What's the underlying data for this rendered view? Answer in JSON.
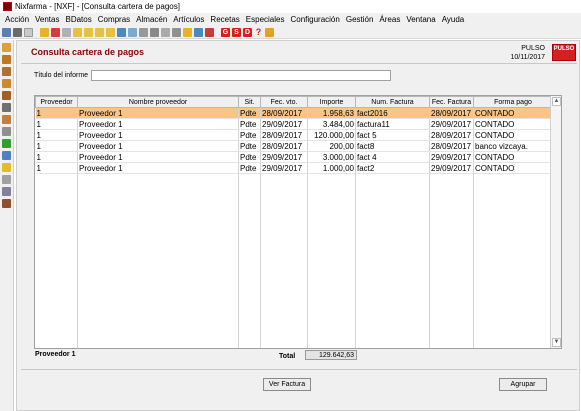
{
  "window": {
    "title": "Nixfarma - [NXF] - [Consulta cartera de pagos]"
  },
  "menu": [
    "Acción",
    "Ventas",
    "BDatos",
    "Compras",
    "Almacén",
    "Artículos",
    "Recetas",
    "Especiales",
    "Configuración",
    "Gestión",
    "Áreas",
    "Ventana",
    "Ayuda"
  ],
  "toolbar": {
    "g": "G",
    "s": "S",
    "d": "D",
    "help": "?"
  },
  "panel": {
    "title": "Consulta cartera de pagos",
    "company": "PULSO",
    "date": "10/11/2017",
    "logo": "PULSO",
    "informe_label": "Título del informe",
    "informe_value": ""
  },
  "table": {
    "columns": [
      "Proveedor",
      "Nombre proveedor",
      "Sit.",
      "Fec. vto.",
      "Importe",
      "Num. Factura",
      "Fec. Factura",
      "Forma pago"
    ],
    "rows": [
      [
        "1",
        "Proveedor 1",
        "Pdte",
        "28/09/2017",
        "1.958,63",
        "fact2016",
        "28/09/2017",
        "CONTADO"
      ],
      [
        "1",
        "Proveedor 1",
        "Pdte",
        "29/09/2017",
        "3.484,00",
        "factura11",
        "29/09/2017",
        "CONTADO"
      ],
      [
        "1",
        "Proveedor 1",
        "Pdte",
        "28/09/2017",
        "120.000,00",
        "fact 5",
        "28/09/2017",
        "CONTADO"
      ],
      [
        "1",
        "Proveedor 1",
        "Pdte",
        "28/09/2017",
        "200,00",
        "fact8",
        "28/09/2017",
        "banco vizcaya."
      ],
      [
        "1",
        "Proveedor 1",
        "Pdte",
        "29/09/2017",
        "3.000,00",
        "fact 4",
        "29/09/2017",
        "CONTADO"
      ],
      [
        "1",
        "Proveedor 1",
        "Pdte",
        "29/09/2017",
        "1.000,00",
        "fact2",
        "29/09/2017",
        "CONTADO"
      ]
    ]
  },
  "footer": {
    "proveedor": "Proveedor 1",
    "total_label": "Total",
    "total_value": "129.642,63",
    "ver_factura": "Ver Factura",
    "agrupar": "Agrupar"
  }
}
